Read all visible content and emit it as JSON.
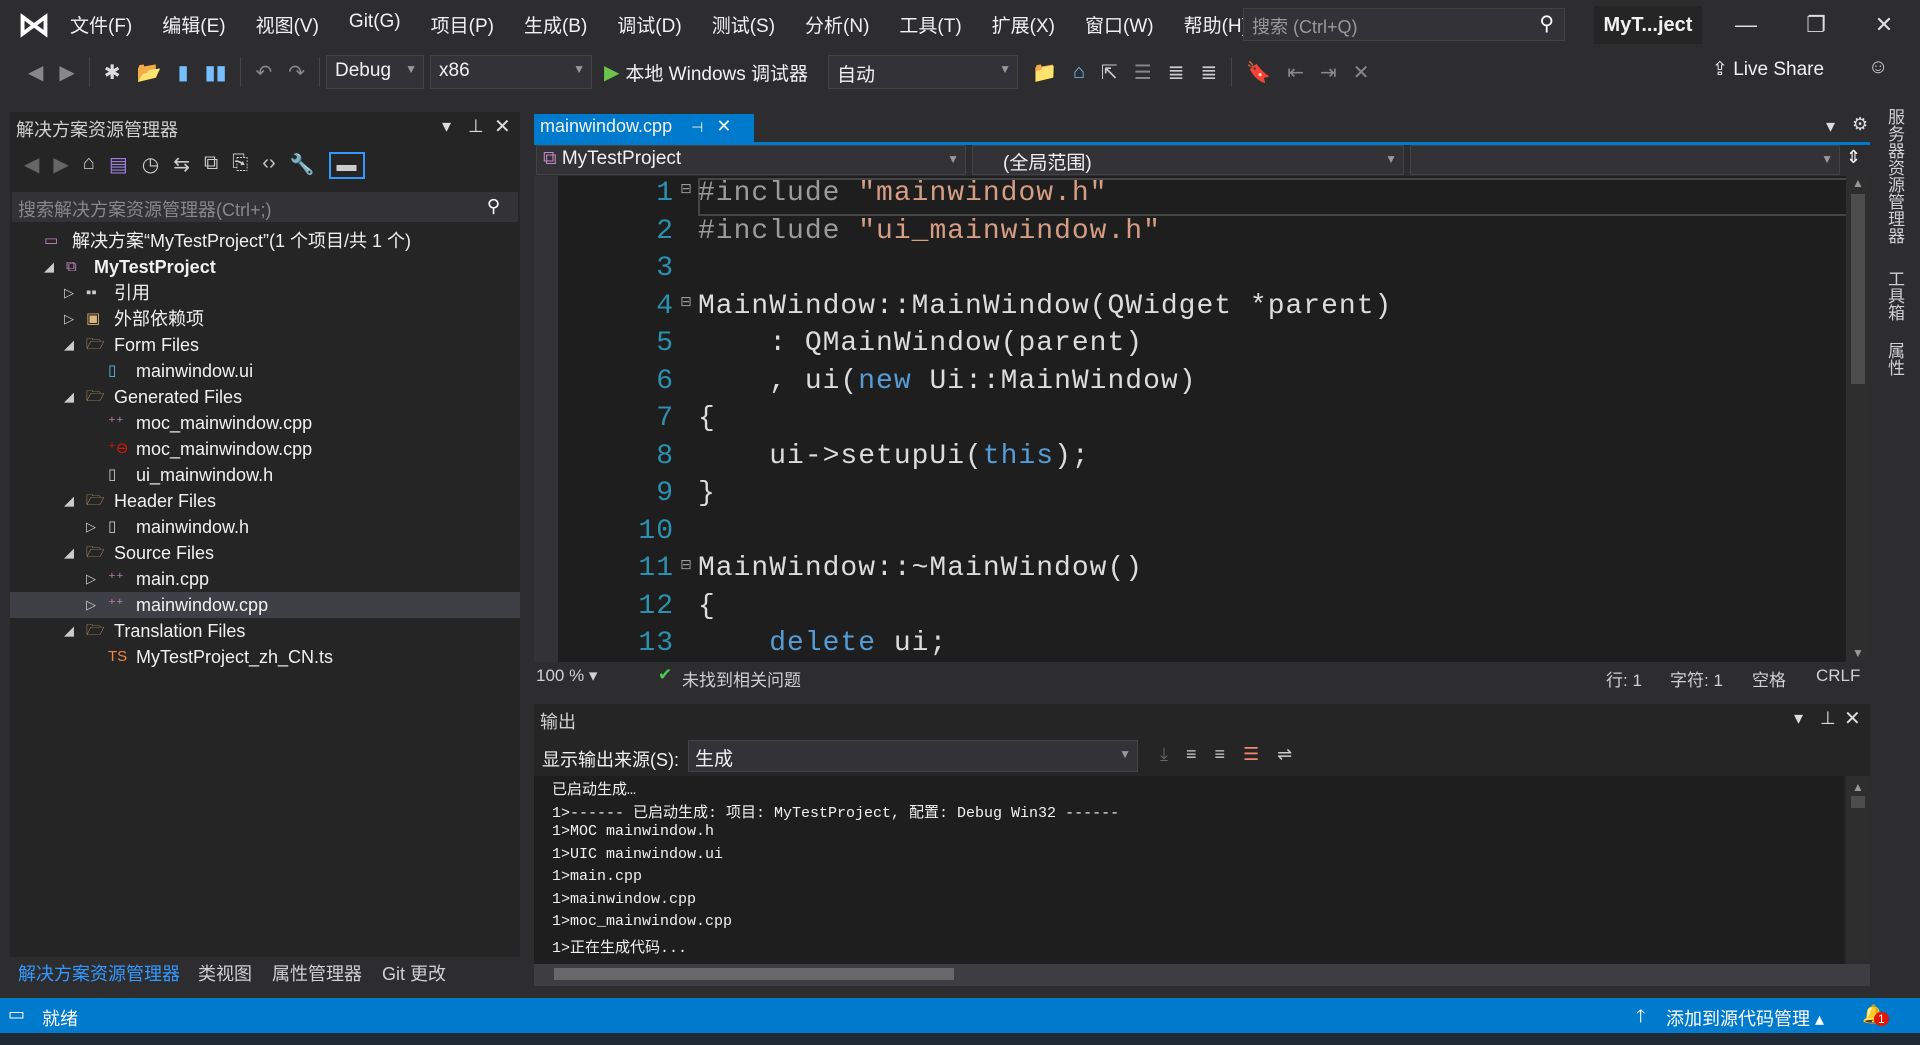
{
  "menu": {
    "items": [
      "文件(F)",
      "编辑(E)",
      "视图(V)",
      "Git(G)",
      "项目(P)",
      "生成(B)",
      "调试(D)",
      "测试(S)",
      "分析(N)",
      "工具(T)",
      "扩展(X)",
      "窗口(W)",
      "帮助(H)"
    ],
    "search_placeholder": "搜索 (Ctrl+Q)",
    "project_title": "MyT...ject"
  },
  "toolbar": {
    "config": "Debug",
    "platform": "x86",
    "run_label": "本地 Windows 调试器",
    "run_mode": "自动",
    "live_share": "Live Share"
  },
  "solution_explorer": {
    "title": "解决方案资源管理器",
    "search_placeholder": "搜索解决方案资源管理器(Ctrl+;)",
    "tree": [
      {
        "label": "解决方案“MyTestProject”(1 个项目/共 1 个)",
        "depth": 0,
        "icon": "solution-icon",
        "arrow": ""
      },
      {
        "label": "MyTestProject",
        "depth": 1,
        "icon": "project-icon",
        "arrow": "expanded",
        "bold": true
      },
      {
        "label": "引用",
        "depth": 2,
        "icon": "references-icon",
        "arrow": "collapsed"
      },
      {
        "label": "外部依赖项",
        "depth": 2,
        "icon": "external-deps-icon",
        "arrow": "collapsed"
      },
      {
        "label": "Form Files",
        "depth": 2,
        "icon": "filter-folder-icon",
        "arrow": "expanded"
      },
      {
        "label": "mainwindow.ui",
        "depth": 3,
        "icon": "ui-file-icon",
        "arrow": ""
      },
      {
        "label": "Generated Files",
        "depth": 2,
        "icon": "filter-folder-icon",
        "arrow": "expanded"
      },
      {
        "label": "moc_mainwindow.cpp",
        "depth": 3,
        "icon": "cpp-file-icon",
        "arrow": ""
      },
      {
        "label": "moc_mainwindow.cpp",
        "depth": 3,
        "icon": "cpp-excluded-file-icon",
        "arrow": ""
      },
      {
        "label": "ui_mainwindow.h",
        "depth": 3,
        "icon": "header-file-icon",
        "arrow": ""
      },
      {
        "label": "Header Files",
        "depth": 2,
        "icon": "filter-folder-icon",
        "arrow": "expanded"
      },
      {
        "label": "mainwindow.h",
        "depth": 3,
        "icon": "header-file-icon",
        "arrow": "collapsed"
      },
      {
        "label": "Source Files",
        "depth": 2,
        "icon": "filter-folder-icon",
        "arrow": "expanded"
      },
      {
        "label": "main.cpp",
        "depth": 3,
        "icon": "cpp-file-icon",
        "arrow": "collapsed"
      },
      {
        "label": "mainwindow.cpp",
        "depth": 3,
        "icon": "cpp-file-icon",
        "arrow": "collapsed",
        "selected": true
      },
      {
        "label": "Translation Files",
        "depth": 2,
        "icon": "filter-folder-icon",
        "arrow": "expanded"
      },
      {
        "label": "MyTestProject_zh_CN.ts",
        "depth": 3,
        "icon": "ts-file-icon",
        "arrow": ""
      }
    ],
    "bottom_tabs": [
      "解决方案资源管理器",
      "类视图",
      "属性管理器",
      "Git 更改"
    ]
  },
  "editor": {
    "tab": "mainwindow.cpp",
    "nav_project": "MyTestProject",
    "nav_scope": "(全局范围)",
    "lines": [
      [
        [
          "pp",
          "#include "
        ],
        [
          "str",
          "\"mainwindow.h\""
        ]
      ],
      [
        [
          "pp",
          "#include "
        ],
        [
          "str",
          "\"ui_mainwindow.h\""
        ]
      ],
      [],
      [
        [
          "",
          "MainWindow::MainWindow(QWidget *parent)"
        ]
      ],
      [
        [
          "",
          "    : QMainWindow(parent)"
        ]
      ],
      [
        [
          "",
          "    , ui("
        ],
        [
          "kw",
          "new"
        ],
        [
          "",
          " Ui::MainWindow)"
        ]
      ],
      [
        [
          "",
          "{"
        ]
      ],
      [
        [
          "",
          "    ui->setupUi("
        ],
        [
          "kw",
          "this"
        ],
        [
          "",
          ");"
        ]
      ],
      [
        [
          "",
          "}"
        ]
      ],
      [],
      [
        [
          "",
          "MainWindow::~MainWindow()"
        ]
      ],
      [
        [
          "",
          "{"
        ]
      ],
      [
        [
          "",
          "    "
        ],
        [
          "kw",
          "delete"
        ],
        [
          "",
          " ui;"
        ]
      ]
    ],
    "zoom": "100 %",
    "issues": "未找到相关问题",
    "line": "行: 1",
    "col": "字符: 1",
    "indent": "空格",
    "eol": "CRLF"
  },
  "output": {
    "title": "输出",
    "source_label": "显示输出来源(S):",
    "source_value": "生成",
    "lines": [
      "已启动生成…",
      "1>------ 已启动生成: 项目: MyTestProject, 配置: Debug Win32 ------",
      "1>MOC mainwindow.h",
      "1>UIC mainwindow.ui",
      "1>main.cpp",
      "1>mainwindow.cpp",
      "1>moc_mainwindow.cpp",
      "1>正在生成代码..."
    ]
  },
  "side_tabs": [
    "服务器资源管理器",
    "工具箱",
    "属性"
  ],
  "status": {
    "ready": "就绪",
    "source_control": "添加到源代码管理",
    "notifications": "1"
  },
  "colors": {
    "accent": "#007acc",
    "keyword": "#569cd6",
    "string": "#d69d85",
    "line_number": "#2b91af"
  }
}
